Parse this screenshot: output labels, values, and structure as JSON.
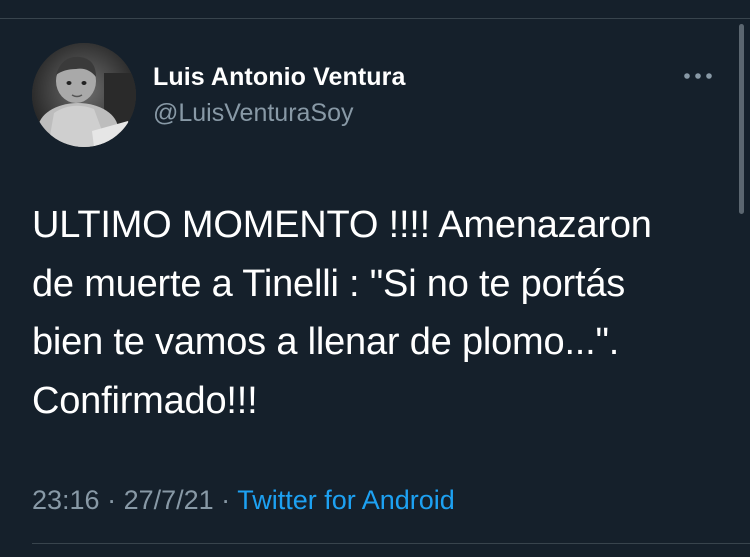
{
  "tweet": {
    "author_name": "Luis Antonio Ventura",
    "author_handle": "@LuisVenturaSoy",
    "text": "ULTIMO MOMENTO !!!! Amenazaron\nde muerte a Tinelli : \"Si no te portás\nbien te vamos a llenar  de plomo...\".\nConfirmado!!!",
    "time": "23:16",
    "date": "27/7/21",
    "separator": " · ",
    "source": "Twitter for Android"
  },
  "icons": {
    "more": "more-horizontal-icon",
    "avatar": "profile-photo"
  },
  "colors": {
    "background": "#15202b",
    "text": "#ffffff",
    "secondary_text": "#8899a6",
    "link": "#1da1f2",
    "divider": "#38444d"
  }
}
